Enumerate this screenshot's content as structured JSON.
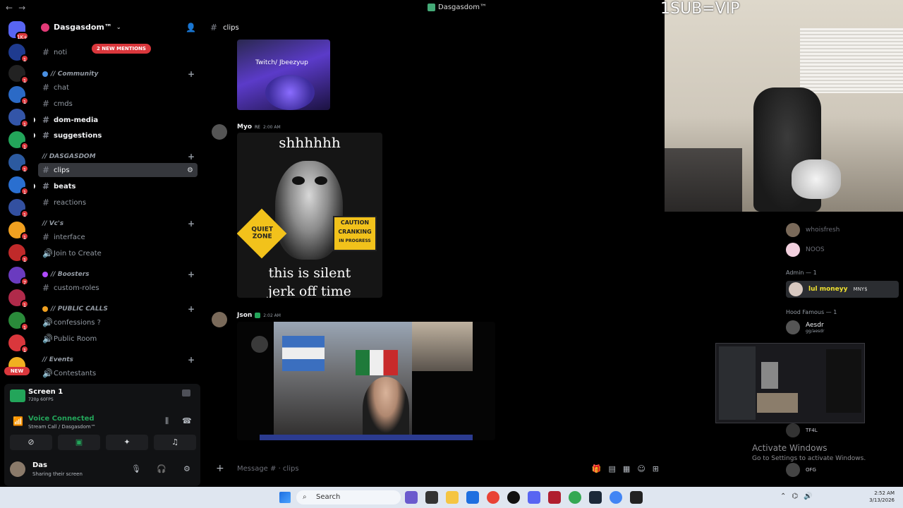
{
  "window": {
    "title": "Dasgasdom™"
  },
  "overlay": {
    "sub_text": "1SUB=VIP"
  },
  "server": {
    "name": "Dasgasdom™",
    "mentions_pill": "2 NEW MENTIONS"
  },
  "rail": {
    "new_label": "NEW"
  },
  "categories": {
    "community": "// Community",
    "dasgasdom": "// DASGASDOM",
    "vcs": "// Vc's",
    "boosters": "// Boosters",
    "public_calls": "// PUBLIC CALLS",
    "events": "// Events"
  },
  "channels": {
    "noti": "noti",
    "chat": "chat",
    "cmds": "cmds",
    "dom_media": "dom-media",
    "suggestions": "suggestions",
    "clips": "clips",
    "beats": "beats",
    "reactions": "reactions",
    "interface": "interface",
    "join_to_create": "Join to Create",
    "custom_roles": "custom-roles",
    "confessions": "confessions ?",
    "public_room": "Public Room",
    "contestants": "Contestants"
  },
  "panel": {
    "stream_title": "Screen 1",
    "stream_sub": "720p 60FPS",
    "voice_title": "Voice Connected",
    "voice_sub": "Stream Call / Dasgasdom™",
    "user_name": "Das",
    "user_status": "Sharing their screen"
  },
  "chat": {
    "channel": "clips",
    "messages": [
      {
        "image_caption": "Twitch/ Jbeezyup"
      },
      {
        "author": "Myo",
        "tag": "RE",
        "time": "2:00 AM",
        "meme_top": "shhhhhh",
        "sign_left": "QUIET ZONE",
        "sign_right_1": "CAUTION",
        "sign_right_2": "CRANKING",
        "sign_right_3": "IN PROGRESS",
        "meme_bottom_1": "this is silent",
        "meme_bottom_2": "jerk off time"
      },
      {
        "author": "Json",
        "time": "2:02 AM"
      }
    ],
    "composer_placeholder": "Message # · clips"
  },
  "members": {
    "group_admin": "Admin — 1",
    "group_hood": "Hood Famous — 1",
    "admin_member": "lul moneyy",
    "admin_tag": "MNY$",
    "hood_member": "Aesdr",
    "hood_sub": "gg/aesdr",
    "m1": "whoisfresh",
    "m2": "NOOS",
    "m3": "TF4L",
    "m4": "OFG"
  },
  "watermark": {
    "line1": "Activate Windows",
    "line2": "Go to Settings to activate Windows."
  },
  "taskbar": {
    "search_label": "Search",
    "time": "2:52 AM",
    "date": "3/13/2026"
  },
  "colors": {
    "accent": "#5865f2",
    "online": "#23a55a",
    "mention": "#da373c",
    "admin_name": "#f0e130"
  }
}
